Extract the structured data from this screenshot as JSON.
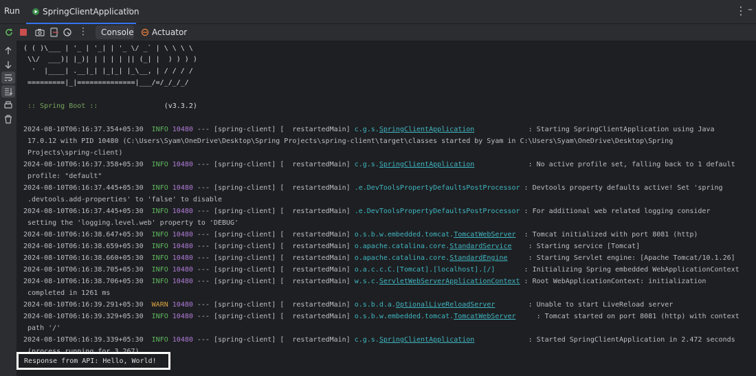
{
  "tool_window": {
    "title": "Run",
    "tab_label": "SpringClientApplication",
    "close_glyph": "×"
  },
  "toolbar": {
    "tabs": [
      "Console",
      "Actuator"
    ]
  },
  "banner": [
    "( ( )\\___ | '_ | '_| | '_ \\/ _` | \\ \\ \\ \\",
    " \\\\/  ___)| |_)| | | | | || (_| |  ) ) ) )",
    "  '  |____| .__|_| |_|_| |_\\__, | / / / /",
    " =========|_|==============|___/=/_/_/_/"
  ],
  "spring_line": {
    "label": " :: Spring Boot :: ",
    "version": "               (v3.3.2)"
  },
  "log": [
    {
      "ts": "2024-08-10T06:16:37.354+05:30",
      "level": "INFO",
      "pid": "10480",
      "mid": " --- [spring-client] [  restartedMain] ",
      "pre": "c.g.s.",
      "link": "SpringClientApplication",
      "pad": "            ",
      "msg": " : Starting SpringClientApplication using Java",
      "cont": [
        " 17.0.12 with PID 10480 (C:\\Users\\Syam\\OneDrive\\Desktop\\Spring Projects\\spring-client\\target\\classes started by Syam in C:\\Users\\Syam\\OneDrive\\Desktop\\Spring",
        " Projects\\spring-client)"
      ]
    },
    {
      "ts": "2024-08-10T06:16:37.358+05:30",
      "level": "INFO",
      "pid": "10480",
      "mid": " --- [spring-client] [  restartedMain] ",
      "pre": "c.g.s.",
      "link": "SpringClientApplication",
      "pad": "            ",
      "msg": " : No active profile set, falling back to 1 default",
      "cont": [
        " profile: \"default\""
      ]
    },
    {
      "ts": "2024-08-10T06:16:37.445+05:30",
      "level": "INFO",
      "pid": "10480",
      "mid": " --- [spring-client] [  restartedMain] ",
      "pre": ".e.DevToolsPropertyDefaultsPostProcessor",
      "link": "",
      "pad": "",
      "msg": " : Devtools property defaults active! Set 'spring",
      "cont": [
        " .devtools.add-properties' to 'false' to disable"
      ]
    },
    {
      "ts": "2024-08-10T06:16:37.445+05:30",
      "level": "INFO",
      "pid": "10480",
      "mid": " --- [spring-client] [  restartedMain] ",
      "pre": ".e.DevToolsPropertyDefaultsPostProcessor",
      "link": "",
      "pad": "",
      "msg": " : For additional web related logging consider",
      "cont": [
        " setting the 'logging.level.web' property to 'DEBUG'"
      ]
    },
    {
      "ts": "2024-08-10T06:16:38.647+05:30",
      "level": "INFO",
      "pid": "10480",
      "mid": " --- [spring-client] [  restartedMain] ",
      "pre": "o.s.b.w.embedded.tomcat.",
      "link": "TomcatWebServer",
      "pad": " ",
      "msg": " : Tomcat initialized with port 8081 (http)",
      "cont": []
    },
    {
      "ts": "2024-08-10T06:16:38.659+05:30",
      "level": "INFO",
      "pid": "10480",
      "mid": " --- [spring-client] [  restartedMain] ",
      "pre": "o.apache.catalina.core.",
      "link": "StandardService",
      "pad": "   ",
      "msg": " : Starting service [Tomcat]",
      "cont": []
    },
    {
      "ts": "2024-08-10T06:16:38.660+05:30",
      "level": "INFO",
      "pid": "10480",
      "mid": " --- [spring-client] [  restartedMain] ",
      "pre": "o.apache.catalina.core.",
      "link": "StandardEngine",
      "pad": "    ",
      "msg": " : Starting Servlet engine: [Apache Tomcat/10.1.26]",
      "cont": []
    },
    {
      "ts": "2024-08-10T06:16:38.705+05:30",
      "level": "INFO",
      "pid": "10480",
      "mid": " --- [spring-client] [  restartedMain] ",
      "pre": "o.a.c.c.C.[Tomcat].[localhost].[/]",
      "link": "",
      "pad": "      ",
      "msg": " : Initializing Spring embedded WebApplicationContext",
      "cont": []
    },
    {
      "ts": "2024-08-10T06:16:38.706+05:30",
      "level": "INFO",
      "pid": "10480",
      "mid": " --- [spring-client] [  restartedMain] ",
      "pre": "w.s.c.",
      "link": "ServletWebServerApplicationContext",
      "pad": "",
      "msg": " : Root WebApplicationContext: initialization",
      "cont": [
        " completed in 1261 ms"
      ]
    },
    {
      "ts": "2024-08-10T06:16:39.291+05:30",
      "level": "WARN",
      "pid": "10480",
      "mid": " --- [spring-client] [  restartedMain] ",
      "pre": "o.s.b.d.a.",
      "link": "OptionalLiveReloadServer",
      "pad": "       ",
      "msg": " : Unable to start LiveReload server",
      "cont": []
    },
    {
      "ts": "2024-08-10T06:16:39.329+05:30",
      "level": "INFO",
      "pid": "10480",
      "mid": " --- [spring-client] [  restartedMain] ",
      "pre": "o.s.b.w.embedded.tomcat.",
      "link": "TomcatWebServer",
      "pad": "    ",
      "msg": " : Tomcat started on port 8081 (http) with context",
      "cont": [
        " path '/'"
      ]
    },
    {
      "ts": "2024-08-10T06:16:39.339+05:30",
      "level": "INFO",
      "pid": "10480",
      "mid": " --- [spring-client] [  restartedMain] ",
      "pre": "c.g.s.",
      "link": "SpringClientApplication",
      "pad": "            ",
      "msg": " : Started SpringClientApplication in 2.472 seconds",
      "cont": [
        " (process running for 3.267)"
      ]
    }
  ],
  "response_line": "Response from API: Hello, World!",
  "colors": {
    "background": "#1e1f22",
    "panel": "#2b2d30",
    "info": "#5fb85f",
    "warn": "#d9a343",
    "pid": "#b07cd8",
    "logger": "#3fb6c2",
    "accent": "#3574f0"
  },
  "icons": {
    "tab": "run-app-icon",
    "toolbar": [
      "rerun-icon",
      "stop-icon",
      "camera-icon",
      "exit-icon",
      "settings-icon",
      "more-vertical-icon"
    ],
    "actuator": "actuator-icon",
    "sidebar": [
      "arrow-up-icon",
      "arrow-down-icon",
      "soft-wrap-icon",
      "scroll-to-end-icon",
      "print-icon",
      "trash-icon"
    ]
  }
}
